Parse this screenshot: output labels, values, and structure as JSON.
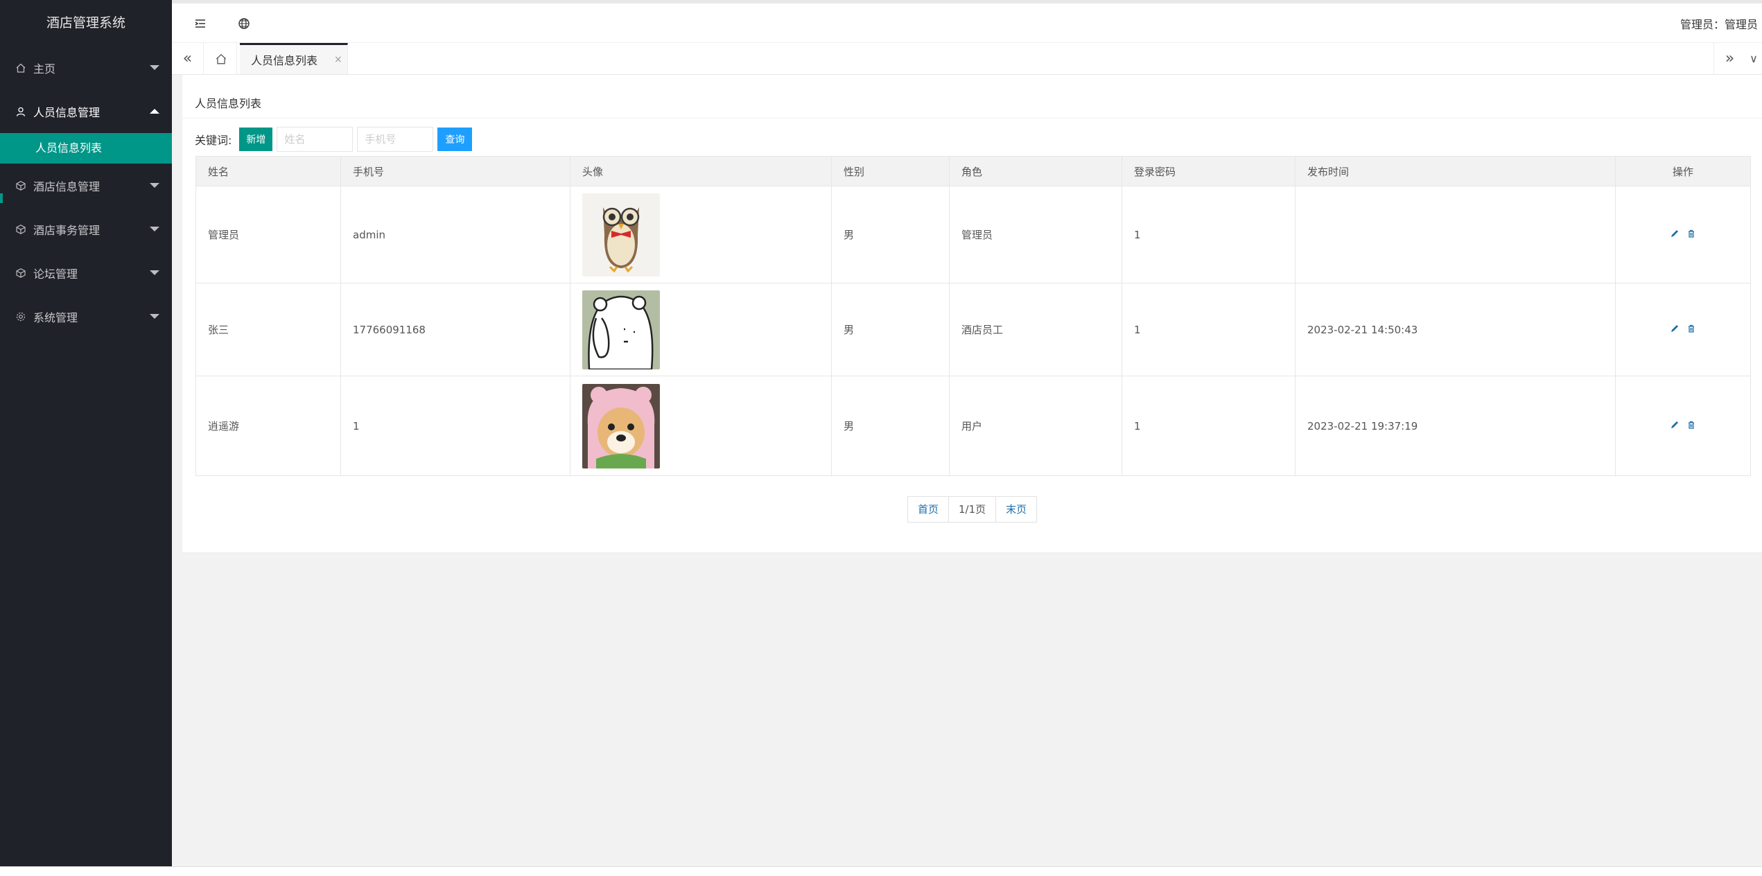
{
  "app": {
    "title": "酒店管理系统"
  },
  "sidebar": {
    "items": [
      {
        "label": "主页",
        "icon": "home-icon"
      },
      {
        "label": "人员信息管理",
        "icon": "user-icon",
        "open": true,
        "sub": [
          "人员信息列表"
        ]
      },
      {
        "label": "酒店信息管理",
        "icon": "cube-icon"
      },
      {
        "label": "酒店事务管理",
        "icon": "cube-icon"
      },
      {
        "label": "论坛管理",
        "icon": "cube-icon"
      },
      {
        "label": "系统管理",
        "icon": "gear-icon"
      }
    ]
  },
  "header": {
    "user_label": "管理员：管理员"
  },
  "tabs": {
    "active": "人员信息列表",
    "close": "×"
  },
  "page": {
    "title": "人员信息列表",
    "keyword_label": "关键词:",
    "add_label": "新增",
    "search_label": "查询",
    "name_placeholder": "姓名",
    "phone_placeholder": "手机号"
  },
  "table": {
    "headers": [
      "姓名",
      "手机号",
      "头像",
      "性别",
      "角色",
      "登录密码",
      "发布时间",
      "操作"
    ],
    "rows": [
      {
        "name": "管理员",
        "phone": "admin",
        "avatar": "owl-avatar",
        "gender": "男",
        "role": "管理员",
        "password": "1",
        "time": ""
      },
      {
        "name": "张三",
        "phone": "17766091168",
        "avatar": "bear-avatar",
        "gender": "男",
        "role": "酒店员工",
        "password": "1",
        "time": "2023-02-21 14:50:43"
      },
      {
        "name": "逍遥游",
        "phone": "1",
        "avatar": "dog-avatar",
        "gender": "男",
        "role": "用户",
        "password": "1",
        "time": "2023-02-21 19:37:19"
      }
    ]
  },
  "pager": {
    "first": "首页",
    "current": "1/1页",
    "last": "末页"
  },
  "colors": {
    "sidebar_bg": "#20222a",
    "accent": "#009688",
    "search_btn": "#1e9fff"
  }
}
